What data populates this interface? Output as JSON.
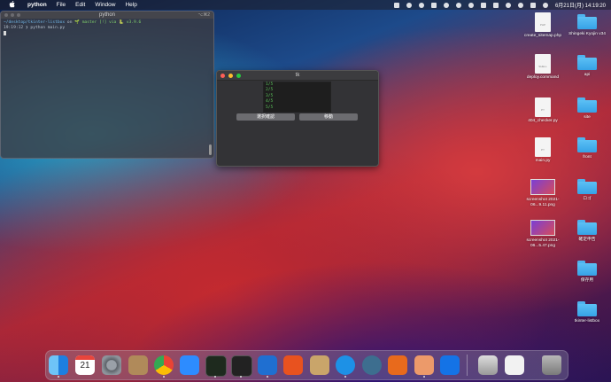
{
  "menubar": {
    "app": "python",
    "items": [
      "File",
      "Edit",
      "Window",
      "Help"
    ],
    "datetime": "6月21日(月) 14:19:20"
  },
  "terminal": {
    "title": "python",
    "shortcut": "⌥⌘2",
    "lines": [
      {
        "path": "~/desktop/tkinter-listbox",
        "on": " on ",
        "branch": "🌱 master [!] via 🐍 v3.9.6"
      },
      {
        "text": "19:19:12 ❯ python main.py"
      }
    ]
  },
  "tk": {
    "title": "tk",
    "listbox_items": [
      "1/5",
      "2/5",
      "3/5",
      "4/5",
      "5/5"
    ],
    "btn_confirm": "選択確認",
    "btn_move": "移動"
  },
  "desktop": {
    "icons": [
      {
        "label": "create_sitemap.php",
        "kind": "doc",
        "tag": "PHP"
      },
      {
        "label": "Shingeki Kyojin v34",
        "kind": "folder"
      },
      {
        "label": "deploy.command",
        "kind": "doc",
        "tag": "SHELL"
      },
      {
        "label": "api",
        "kind": "folder"
      },
      {
        "label": "404_checker.py",
        "kind": "doc",
        "tag": "PY"
      },
      {
        "label": "site",
        "kind": "folder"
      },
      {
        "label": "main.py",
        "kind": "doc",
        "tag": "PY"
      },
      {
        "label": "front",
        "kind": "folder"
      },
      {
        "label": "screenshot 2021-06...9.11.png",
        "kind": "image"
      },
      {
        "label": "ロゴ",
        "kind": "folder"
      },
      {
        "label": "screenshot 2021-06...5.47.png",
        "kind": "image"
      },
      {
        "label": "確定申告",
        "kind": "folder"
      },
      {
        "label": "保存用",
        "kind": "folder"
      },
      {
        "label": "tkinter-listbox",
        "kind": "folder"
      }
    ]
  },
  "dock": {
    "calendar_day": "21",
    "apps": [
      "finder",
      "calendar",
      "system-preferences",
      "contacts",
      "chrome",
      "zoom",
      "terminal-green",
      "terminal",
      "vscode",
      "instruments",
      "archive",
      "docker",
      "quicktime",
      "sourcetree",
      "preview",
      "infinity",
      "screenshot-preview",
      "document",
      "trash"
    ]
  }
}
